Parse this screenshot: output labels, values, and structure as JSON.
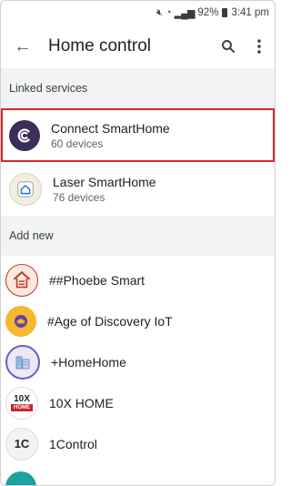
{
  "status_bar": {
    "battery": "92%",
    "time": "3:41 pm"
  },
  "app_bar": {
    "title": "Home control"
  },
  "linked": {
    "header": "Linked services",
    "items": [
      {
        "name": "Connect SmartHome",
        "devices": "60 devices"
      },
      {
        "name": "Laser SmartHome",
        "devices": "76 devices"
      }
    ]
  },
  "add_new": {
    "header": "Add new",
    "items": [
      {
        "name": "##Phoebe Smart"
      },
      {
        "name": "#Age of Discovery IoT"
      },
      {
        "name": "+HomeHome"
      },
      {
        "name": "10X HOME"
      },
      {
        "name": "1Control"
      }
    ]
  },
  "logos": {
    "tenx_top": "10X",
    "tenx_bottom": "HOME",
    "onecontrol": "1C"
  },
  "colors": {
    "highlight": "#d62828",
    "connect_bg": "#3b2e5a",
    "age_bg": "#f5b82e"
  }
}
